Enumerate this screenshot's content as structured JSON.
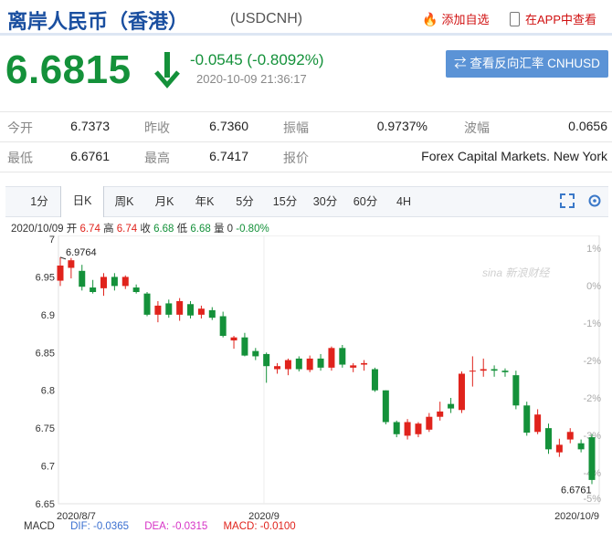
{
  "header": {
    "title": "离岸人民币（香港）",
    "code": "(USDCNH)",
    "add_favorite": "添加自选",
    "app_view": "在APP中查看"
  },
  "quote": {
    "price": "6.6815",
    "change": "-0.0545 (-0.8092%)",
    "time": "2020-10-09 21:36:17",
    "reverse_button": "查看反向汇率 CNHUSD",
    "direction": "down",
    "down_color": "#14913a",
    "up_color": "#e0231c"
  },
  "stats": [
    {
      "label": "今开",
      "value": "6.7373"
    },
    {
      "label": "昨收",
      "value": "6.7360"
    },
    {
      "label": "振幅",
      "value": "0.9737%"
    },
    {
      "label": "波幅",
      "value": "0.0656"
    },
    {
      "label": "最低",
      "value": "6.6761"
    },
    {
      "label": "最高",
      "value": "6.7417"
    },
    {
      "label": "报价",
      "value": "Forex Capital Markets. New York"
    }
  ],
  "tabs": [
    "1分",
    "日K",
    "周K",
    "月K",
    "年K",
    "5分",
    "15分",
    "30分",
    "60分",
    "4H"
  ],
  "active_tab": "日K",
  "ohlc": {
    "date": "2020/10/09",
    "open_label": "开",
    "open": "6.74",
    "high_label": "高",
    "high": "6.74",
    "close_label": "收",
    "close": "6.68",
    "low_label": "低",
    "low": "6.68",
    "vol_label": "量",
    "vol": "0",
    "pct": "-0.80%"
  },
  "chart_data": {
    "type": "candlestick",
    "y_ticks": [
      "7",
      "6.95",
      "6.9",
      "6.85",
      "6.8",
      "6.75",
      "6.7",
      "6.65"
    ],
    "y_pct_ticks": [
      "1%",
      "0%",
      "-1%",
      "-2%",
      "-2%",
      "-3%",
      "-4%",
      "-5%"
    ],
    "x_ticks": [
      "2020/8/7",
      "2020/9",
      "2020/10/9"
    ],
    "ylim": [
      6.65,
      7.0
    ],
    "max_label": "6.9764",
    "min_label": "6.6761",
    "watermark": "新浪财经",
    "up_color": "#e0231c",
    "down_color": "#14913a",
    "candles": [
      {
        "o": 6.945,
        "h": 6.976,
        "l": 6.938,
        "c": 6.965
      },
      {
        "o": 6.962,
        "h": 6.975,
        "l": 6.948,
        "c": 6.972
      },
      {
        "o": 6.958,
        "h": 6.966,
        "l": 6.932,
        "c": 6.937
      },
      {
        "o": 6.936,
        "h": 6.946,
        "l": 6.928,
        "c": 6.93
      },
      {
        "o": 6.935,
        "h": 6.955,
        "l": 6.925,
        "c": 6.95
      },
      {
        "o": 6.95,
        "h": 6.955,
        "l": 6.932,
        "c": 6.938
      },
      {
        "o": 6.938,
        "h": 6.952,
        "l": 6.934,
        "c": 6.95
      },
      {
        "o": 6.936,
        "h": 6.94,
        "l": 6.928,
        "c": 6.93
      },
      {
        "o": 6.928,
        "h": 6.93,
        "l": 6.898,
        "c": 6.9
      },
      {
        "o": 6.9,
        "h": 6.918,
        "l": 6.89,
        "c": 6.912
      },
      {
        "o": 6.915,
        "h": 6.92,
        "l": 6.896,
        "c": 6.9
      },
      {
        "o": 6.9,
        "h": 6.922,
        "l": 6.892,
        "c": 6.918
      },
      {
        "o": 6.914,
        "h": 6.918,
        "l": 6.895,
        "c": 6.899
      },
      {
        "o": 6.9,
        "h": 6.912,
        "l": 6.895,
        "c": 6.908
      },
      {
        "o": 6.906,
        "h": 6.91,
        "l": 6.893,
        "c": 6.896
      },
      {
        "o": 6.898,
        "h": 6.904,
        "l": 6.87,
        "c": 6.872
      },
      {
        "o": 6.866,
        "h": 6.872,
        "l": 6.855,
        "c": 6.87
      },
      {
        "o": 6.87,
        "h": 6.876,
        "l": 6.845,
        "c": 6.846
      },
      {
        "o": 6.852,
        "h": 6.856,
        "l": 6.84,
        "c": 6.845
      },
      {
        "o": 6.848,
        "h": 6.85,
        "l": 6.81,
        "c": 6.832
      },
      {
        "o": 6.828,
        "h": 6.836,
        "l": 6.822,
        "c": 6.832
      },
      {
        "o": 6.828,
        "h": 6.842,
        "l": 6.82,
        "c": 6.84
      },
      {
        "o": 6.842,
        "h": 6.845,
        "l": 6.825,
        "c": 6.828
      },
      {
        "o": 6.827,
        "h": 6.846,
        "l": 6.824,
        "c": 6.842
      },
      {
        "o": 6.842,
        "h": 6.848,
        "l": 6.826,
        "c": 6.83
      },
      {
        "o": 6.83,
        "h": 6.858,
        "l": 6.826,
        "c": 6.856
      },
      {
        "o": 6.856,
        "h": 6.86,
        "l": 6.83,
        "c": 6.834
      },
      {
        "o": 6.83,
        "h": 6.836,
        "l": 6.824,
        "c": 6.833
      },
      {
        "o": 6.834,
        "h": 6.84,
        "l": 6.826,
        "c": 6.836
      },
      {
        "o": 6.828,
        "h": 6.83,
        "l": 6.798,
        "c": 6.8
      },
      {
        "o": 6.8,
        "h": 6.8,
        "l": 6.755,
        "c": 6.758
      },
      {
        "o": 6.758,
        "h": 6.76,
        "l": 6.738,
        "c": 6.742
      },
      {
        "o": 6.74,
        "h": 6.762,
        "l": 6.735,
        "c": 6.758
      },
      {
        "o": 6.742,
        "h": 6.758,
        "l": 6.738,
        "c": 6.756
      },
      {
        "o": 6.748,
        "h": 6.77,
        "l": 6.745,
        "c": 6.765
      },
      {
        "o": 6.765,
        "h": 6.785,
        "l": 6.76,
        "c": 6.772
      },
      {
        "o": 6.782,
        "h": 6.79,
        "l": 6.77,
        "c": 6.776
      },
      {
        "o": 6.774,
        "h": 6.825,
        "l": 6.77,
        "c": 6.822
      },
      {
        "o": 6.825,
        "h": 6.845,
        "l": 6.805,
        "c": 6.826
      },
      {
        "o": 6.826,
        "h": 6.842,
        "l": 6.818,
        "c": 6.828
      },
      {
        "o": 6.828,
        "h": 6.833,
        "l": 6.818,
        "c": 6.826
      },
      {
        "o": 6.826,
        "h": 6.829,
        "l": 6.818,
        "c": 6.824
      },
      {
        "o": 6.82,
        "h": 6.826,
        "l": 6.775,
        "c": 6.78
      },
      {
        "o": 6.78,
        "h": 6.785,
        "l": 6.74,
        "c": 6.744
      },
      {
        "o": 6.745,
        "h": 6.775,
        "l": 6.742,
        "c": 6.768
      },
      {
        "o": 6.75,
        "h": 6.756,
        "l": 6.716,
        "c": 6.722
      },
      {
        "o": 6.718,
        "h": 6.736,
        "l": 6.712,
        "c": 6.728
      },
      {
        "o": 6.735,
        "h": 6.75,
        "l": 6.73,
        "c": 6.745
      },
      {
        "o": 6.73,
        "h": 6.735,
        "l": 6.718,
        "c": 6.722
      },
      {
        "o": 6.738,
        "h": 6.742,
        "l": 6.676,
        "c": 6.6815
      }
    ]
  },
  "macd": {
    "label": "MACD",
    "dif": "DIF: -0.0365",
    "dea": "DEA: -0.0315",
    "macd": "MACD: -0.0100"
  }
}
